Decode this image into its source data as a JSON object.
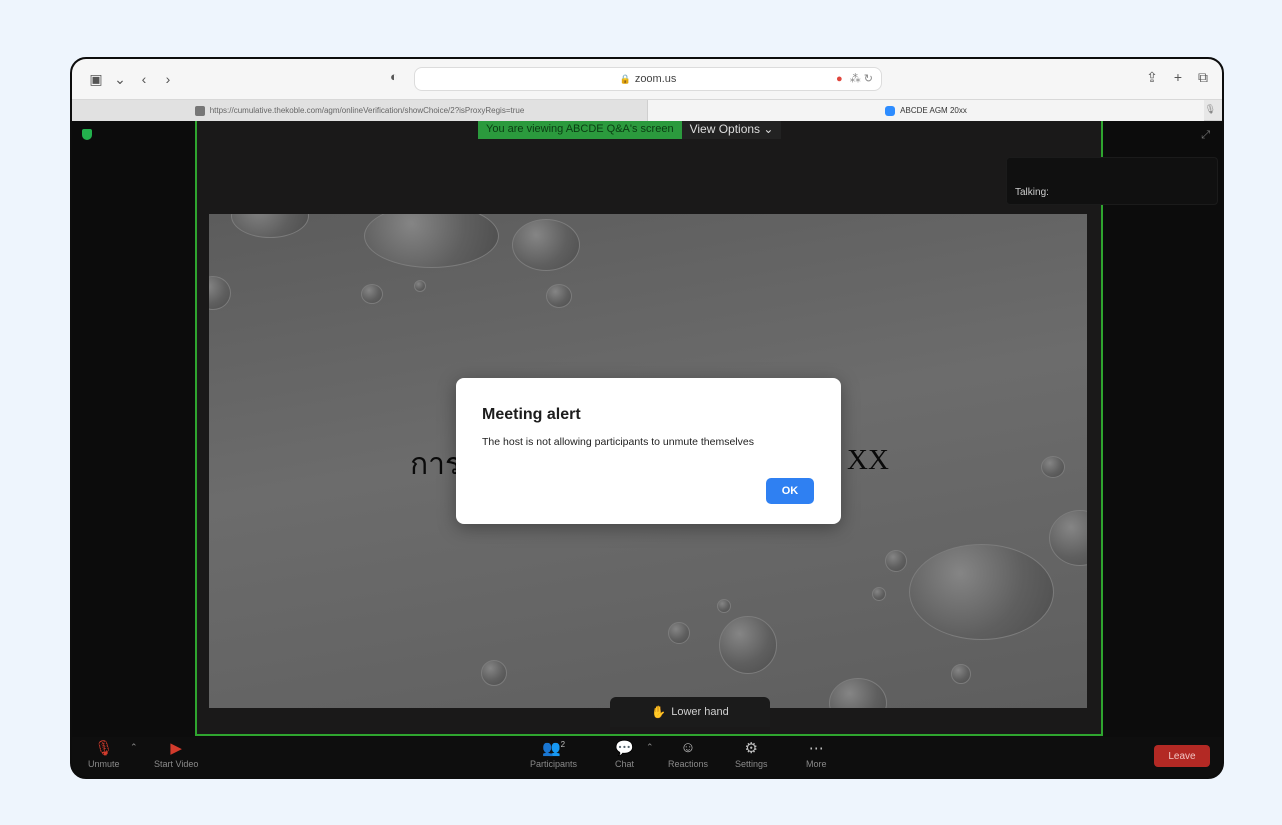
{
  "browser": {
    "address": "zoom.us",
    "tabs": [
      {
        "title": "https://cumulative.thekoble.com/agm/onlineVerification/showChoice/2?isProxyRegis=true"
      },
      {
        "title": "ABCDE AGM 20xx"
      }
    ]
  },
  "zoom": {
    "viewing_banner": "You are viewing ABCDE Q&A's screen",
    "view_options": "View Options",
    "talking_label": "Talking:",
    "slide": {
      "text_left": "การ",
      "text_right": "XX"
    },
    "lower_hand": "Lower hand",
    "controls": {
      "unmute": "Unmute",
      "start_video": "Start Video",
      "participants": "Participants",
      "participants_count": "2",
      "chat": "Chat",
      "reactions": "Reactions",
      "settings": "Settings",
      "more": "More",
      "leave": "Leave"
    }
  },
  "alert": {
    "title": "Meeting alert",
    "message": "The host is not allowing participants to unmute themselves",
    "ok": "OK"
  },
  "colors": {
    "ok_button": "#2f80f2",
    "leave_button": "#b32924",
    "share_border": "#2fa52f"
  }
}
